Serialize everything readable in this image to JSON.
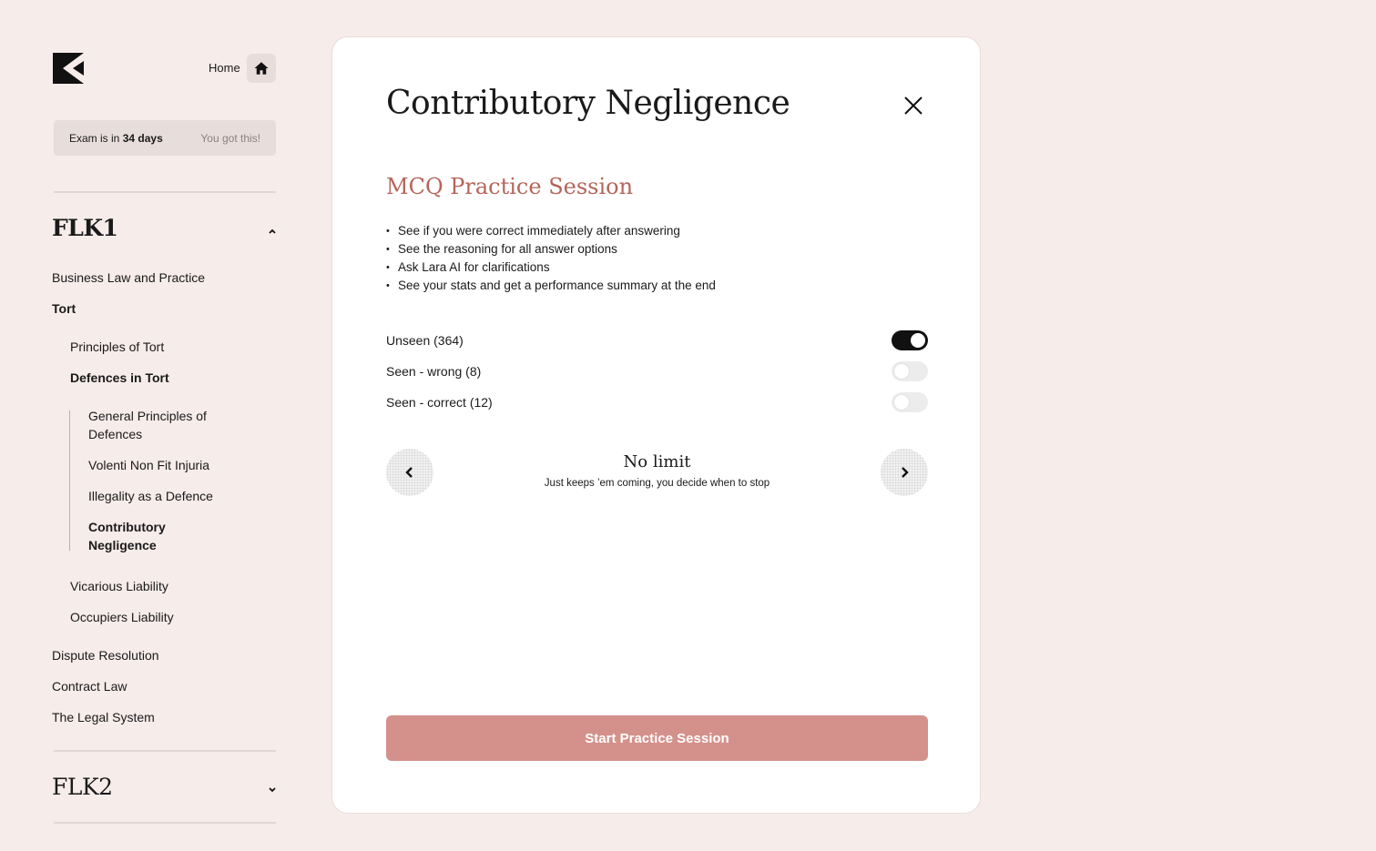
{
  "sidebar": {
    "home_label": "Home",
    "exam_prefix": "Exam is in",
    "exam_days": "34 days",
    "exam_motivation": "You got this!",
    "flk1_title": "FLK1",
    "flk2_title": "FLK2",
    "items": {
      "business_law": "Business Law and Practice",
      "tort": "Tort",
      "principles_of_tort": "Principles of Tort",
      "defences_in_tort": "Defences in Tort",
      "general_principles_line1": "General Principles of",
      "general_principles_line2": "Defences",
      "volenti": "Volenti Non Fit Injuria",
      "illegality": "Illegality as a Defence",
      "contributory_line1": "Contributory",
      "contributory_line2": "Negligence",
      "vicarious": "Vicarious Liability",
      "occupiers": "Occupiers Liability",
      "dispute": "Dispute Resolution",
      "contract": "Contract Law",
      "legal_system": "The Legal System"
    }
  },
  "modal": {
    "title": "Contributory Negligence",
    "session_title": "MCQ Practice Session",
    "bullets": [
      "See if you were correct immediately after answering",
      "See the reasoning for all answer options",
      "Ask Lara AI for clarifications",
      "See your stats and get a performance summary at the end"
    ],
    "filters": [
      {
        "label": "Unseen (364)",
        "state": "on"
      },
      {
        "label": "Seen - wrong (8)",
        "state": "off"
      },
      {
        "label": "Seen - correct (12)",
        "state": "off"
      }
    ],
    "limit_title": "No limit",
    "limit_subtitle": "Just keeps ’em coming, you decide when to stop",
    "start_label": "Start Practice Session"
  },
  "colors": {
    "background": "#f6ecea",
    "accent_text": "#b5655a",
    "start_button": "#d4918b"
  }
}
